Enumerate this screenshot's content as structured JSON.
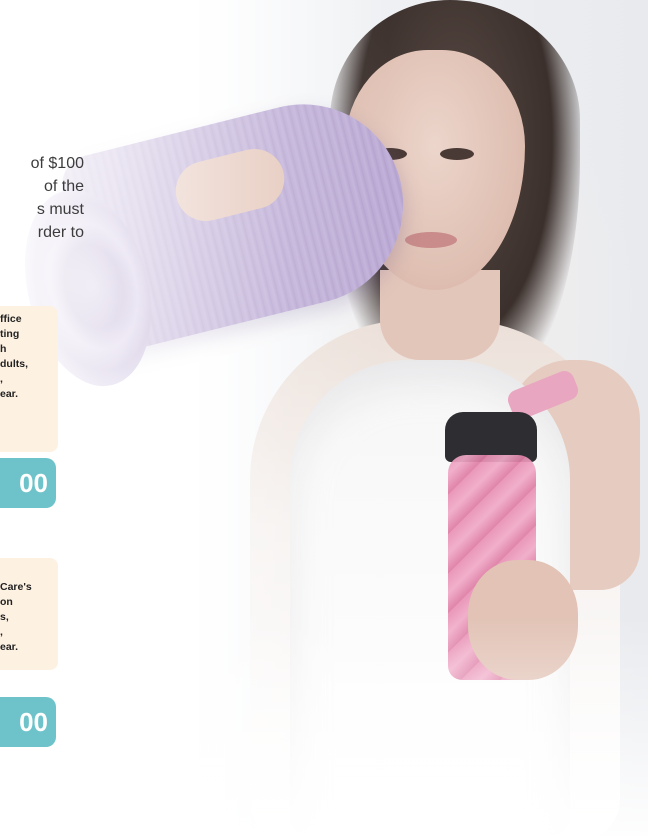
{
  "intro_lines": [
    "of $100",
    "of the",
    "s must",
    "rder to"
  ],
  "card1": {
    "lines": [
      "ffice",
      "ting",
      "h",
      "dults,",
      ",",
      "ear."
    ]
  },
  "price_pill_1": "00",
  "card2": {
    "lines": [
      "Care's",
      "on",
      "s,",
      ",",
      "ear."
    ]
  },
  "price_pill_2": "00",
  "colors": {
    "pill": "#6dc3c9",
    "card_bg": "#fdf1e2",
    "yoga_mat": "#b9a8d2",
    "bottle": "#e88fb3"
  }
}
